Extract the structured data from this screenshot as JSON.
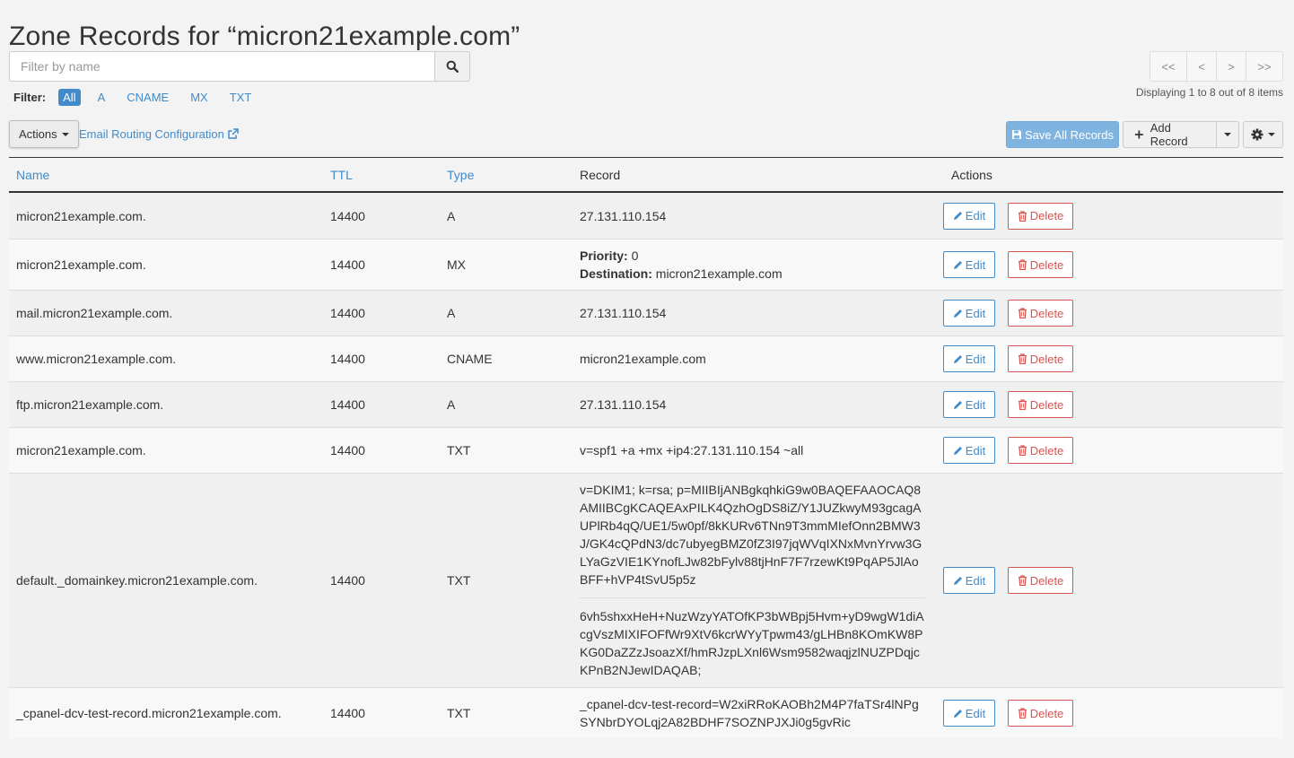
{
  "page": {
    "title": "Zone Records for “micron21example.com”"
  },
  "search": {
    "placeholder": "Filter by name",
    "value": ""
  },
  "filter": {
    "label": "Filter:",
    "options": [
      "All",
      "A",
      "CNAME",
      "MX",
      "TXT"
    ],
    "active": "All"
  },
  "pager": {
    "first": "<<",
    "prev": "<",
    "next": ">",
    "last": ">>",
    "info": "Displaying 1 to 8 out of 8 items"
  },
  "toolbar": {
    "actions_label": "Actions",
    "email_routing_label": "Email Routing Configuration",
    "save_all_label": "Save All Records",
    "add_record_label": "Add Record"
  },
  "table": {
    "headers": {
      "name": "Name",
      "ttl": "TTL",
      "type": "Type",
      "record": "Record",
      "actions": "Actions"
    },
    "edit_label": "Edit",
    "delete_label": "Delete",
    "mx_priority_label": "Priority:",
    "mx_destination_label": "Destination:",
    "rows": [
      {
        "name": "micron21example.com.",
        "ttl": "14400",
        "type": "A",
        "record": "27.131.110.154"
      },
      {
        "name": "micron21example.com.",
        "ttl": "14400",
        "type": "MX",
        "priority": "0",
        "destination": "micron21example.com"
      },
      {
        "name": "mail.micron21example.com.",
        "ttl": "14400",
        "type": "A",
        "record": "27.131.110.154"
      },
      {
        "name": "www.micron21example.com.",
        "ttl": "14400",
        "type": "CNAME",
        "record": "micron21example.com"
      },
      {
        "name": "ftp.micron21example.com.",
        "ttl": "14400",
        "type": "A",
        "record": "27.131.110.154"
      },
      {
        "name": "micron21example.com.",
        "ttl": "14400",
        "type": "TXT",
        "record": "v=spf1 +a +mx +ip4:27.131.110.154 ~all"
      },
      {
        "name": "default._domainkey.micron21example.com.",
        "ttl": "14400",
        "type": "TXT",
        "record_part1": "v=DKIM1; k=rsa; p=MIIBIjANBgkqhkiG9w0BAQEFAAOCAQ8AMIIBCgKCAQEAxPILK4QzhOgDS8iZ/Y1JUZkwyM93gcagAUPlRb4qQ/UE1/5w0pf/8kKURv6TNn9T3mmMIefOnn2BMW3J/GK4cQPdN3/dc7ubyegBMZ0fZ3I97jqWVqIXNxMvnYrvw3GLYaGzVIE1KYnofLJw82bFylv88tjHnF7F7rzewKt9PqAP5JlAoBFF+hVP4tSvU5p5z",
        "record_part2": "6vh5shxxHeH+NuzWzyYATOfKP3bWBpj5Hvm+yD9wgW1diAcgVszMIXIFOFfWr9XtV6kcrWYyTpwm43/gLHBn8KOmKW8PKG0DaZZzJsoazXf/hmRJzpLXnl6Wsm9582waqjzlNUZPDqjcKPnB2NJewIDAQAB;"
      },
      {
        "name": "_cpanel-dcv-test-record.micron21example.com.",
        "ttl": "14400",
        "type": "TXT",
        "record": "_cpanel-dcv-test-record=W2xiRRoKAOBh2M4P7faTSr4lNPgSYNbrDYOLqj2A82BDHF7SOZNPJXJi0g5gvRic"
      }
    ]
  },
  "colors": {
    "link": "#428bca",
    "danger": "#d9534f",
    "save_button": "#7fb3e0"
  },
  "icons": {
    "search": "search-icon",
    "external": "external-link-icon",
    "save": "floppy-disk-icon",
    "add": "plus-icon",
    "gear": "gear-icon",
    "edit": "pencil-icon",
    "delete": "trash-icon"
  }
}
